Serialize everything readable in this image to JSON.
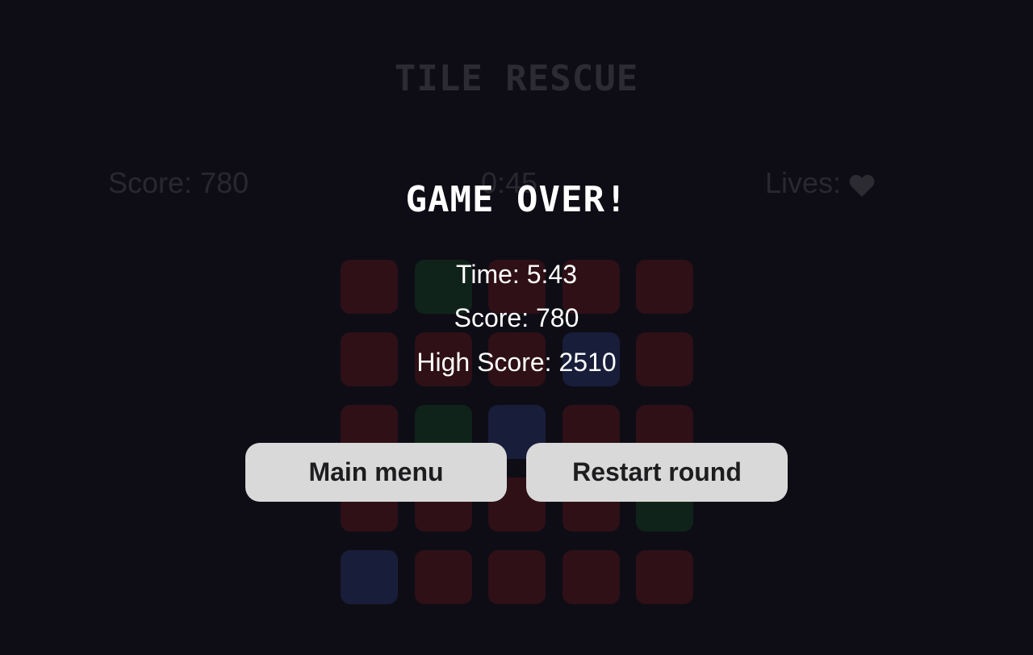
{
  "game": {
    "title": "TILE RESCUE"
  },
  "hud": {
    "score": "Score: 780",
    "timer": "0:45",
    "lives_label": "Lives:",
    "lives_icon": "heart-icon",
    "lives_count": 1
  },
  "board": {
    "rows": 5,
    "cols": 5,
    "tiles": [
      [
        "red",
        "green",
        "red",
        "red",
        "red"
      ],
      [
        "red",
        "red",
        "red",
        "blue",
        "red"
      ],
      [
        "red",
        "green",
        "blue",
        "red",
        "red"
      ],
      [
        "red",
        "red",
        "red",
        "red",
        "green"
      ],
      [
        "blue",
        "red",
        "red",
        "red",
        "red"
      ]
    ],
    "colors": {
      "red": "#2e1016",
      "green": "#10231a",
      "blue": "#181d3a"
    }
  },
  "overlay": {
    "title": "GAME OVER!",
    "time": "Time: 5:43",
    "score": "Score: 780",
    "high_score": "High Score: 2510",
    "buttons": {
      "main_menu": "Main menu",
      "restart": "Restart round"
    }
  },
  "colors": {
    "background": "#0e0d15",
    "button_bg": "#d9d9d9",
    "button_text": "#1d1d1f",
    "overlay_text": "#ffffff"
  }
}
